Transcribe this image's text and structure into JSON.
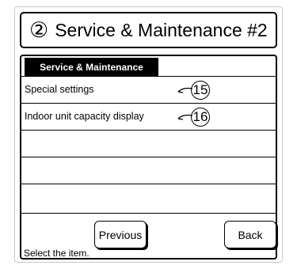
{
  "header": {
    "step_number": "②",
    "title": "Service & Maintenance #2"
  },
  "panel": {
    "tab_label": "Service & Maintenance",
    "items": [
      {
        "label": "Special settings",
        "callout": "15"
      },
      {
        "label": "Indoor unit capacity display",
        "callout": "16"
      },
      {
        "label": "",
        "callout": ""
      },
      {
        "label": "",
        "callout": ""
      },
      {
        "label": "",
        "callout": ""
      }
    ]
  },
  "buttons": {
    "previous_label": "Previous",
    "back_label": "Back"
  },
  "status_text": "Select the item."
}
